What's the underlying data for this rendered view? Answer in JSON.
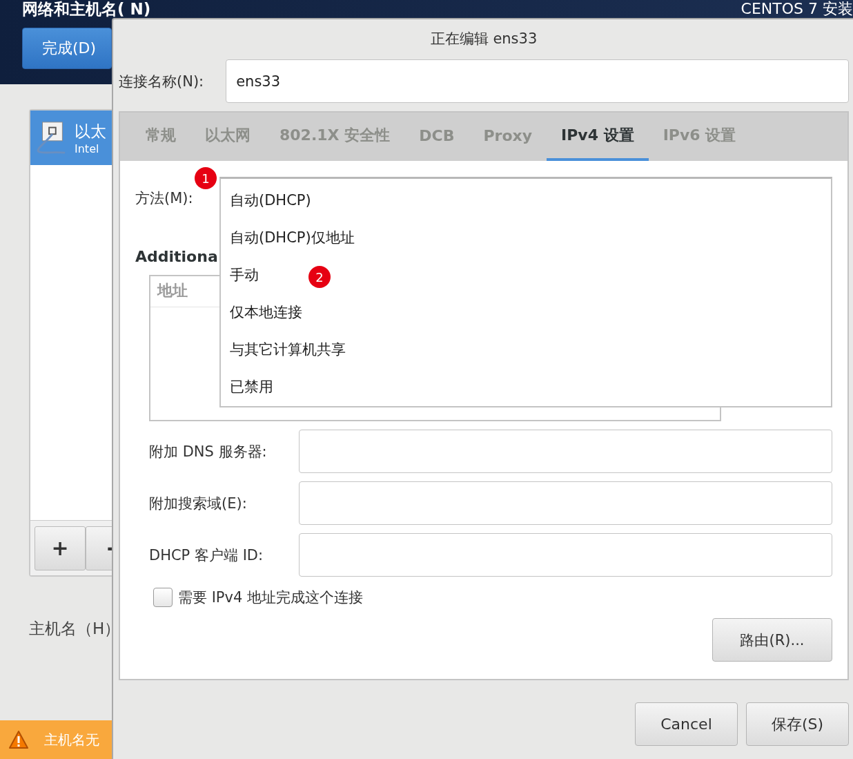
{
  "background": {
    "title": "网络和主机名( N)",
    "product": "CENTOS 7 安装",
    "done_button": "完成(D)",
    "devices": [
      {
        "name": "以太",
        "detail": "Intel",
        "selected": true
      }
    ],
    "add_button": "+",
    "remove_button": "-",
    "hostname_label": "主机名（H）",
    "warning": "主机名无"
  },
  "dialog": {
    "title": "正在编辑 ens33",
    "connection_label": "连接名称(N):",
    "connection_value": "ens33",
    "tabs": [
      {
        "label": "常规",
        "selected": false
      },
      {
        "label": "以太网",
        "selected": false
      },
      {
        "label": "802.1X 安全性",
        "selected": false
      },
      {
        "label": "DCB",
        "selected": false
      },
      {
        "label": "Proxy",
        "selected": false
      },
      {
        "label": "IPv4 设置",
        "selected": true
      },
      {
        "label": "IPv6 设置",
        "selected": false
      }
    ],
    "method_label": "方法(M):",
    "additional_label": "Additiona",
    "address_header": "地址",
    "method_options": [
      {
        "label": "自动(DHCP)"
      },
      {
        "label": "自动(DHCP)仅地址"
      },
      {
        "label": "手动"
      },
      {
        "label": "仅本地连接"
      },
      {
        "label": "与其它计算机共享"
      },
      {
        "label": "已禁用"
      }
    ],
    "fields": [
      {
        "label": "附加 DNS 服务器:"
      },
      {
        "label": "附加搜索域(E):"
      },
      {
        "label": "DHCP 客户端 ID:"
      }
    ],
    "require_ipv4": {
      "label": "需要 IPv4 地址完成这个连接",
      "checked": false
    },
    "routes_button": "路由(R)...",
    "cancel_button": "Cancel",
    "save_button": "保存(S)"
  },
  "markers": [
    {
      "label": "1"
    },
    {
      "label": "2"
    }
  ]
}
